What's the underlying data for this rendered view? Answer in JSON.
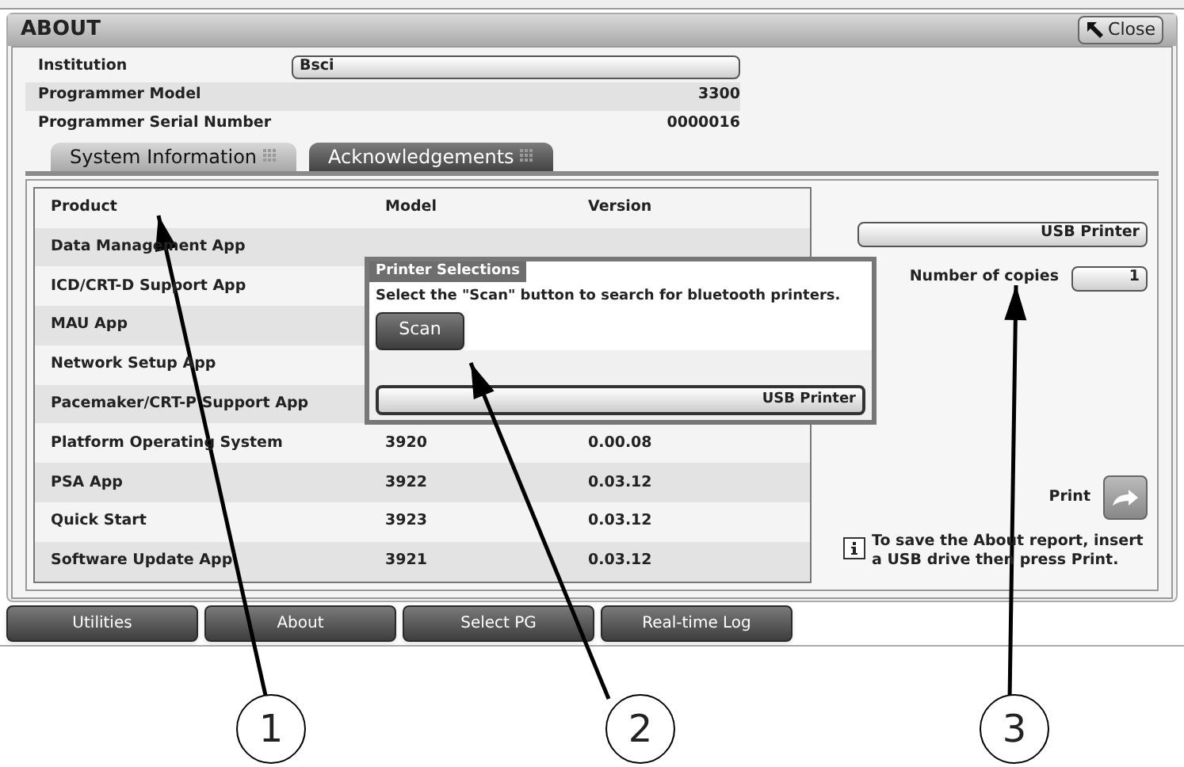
{
  "window": {
    "title": "ABOUT",
    "close_label": "Close"
  },
  "info": [
    {
      "label": "Institution",
      "value": "Bsci",
      "kind": "field"
    },
    {
      "label": "Programmer Model",
      "value": "3300",
      "kind": "text"
    },
    {
      "label": "Programmer Serial Number",
      "value": "0000016",
      "kind": "text"
    }
  ],
  "tabs": [
    {
      "label": "System Information",
      "selected": true
    },
    {
      "label": "Acknowledgements",
      "selected": false
    }
  ],
  "table": {
    "columns": [
      "Product",
      "Model",
      "Version"
    ],
    "rows": [
      {
        "product": "Data Management App"
      },
      {
        "product": "ICD/CRT-D Support App"
      },
      {
        "product": "MAU App"
      },
      {
        "product": "Network Setup App"
      },
      {
        "product": "Pacemaker/CRT-P Support App"
      },
      {
        "product": "Platform Operating System",
        "model": "3920",
        "version": "0.00.08"
      },
      {
        "product": "PSA App",
        "model": "3922",
        "version": "0.03.12"
      },
      {
        "product": "Quick Start",
        "model": "3923",
        "version": "0.03.12"
      },
      {
        "product": "Software Update App",
        "model": "3921",
        "version": "0.03.12"
      }
    ]
  },
  "printer": {
    "value": "USB Printer",
    "copies_label": "Number of copies",
    "copies": "1",
    "print_label": "Print",
    "note": "To save the About report, insert a USB drive then press Print."
  },
  "dialog": {
    "title": "Printer Selections",
    "message": "Select the \"Scan\" button to search for bluetooth printers.",
    "scan_label": "Scan",
    "selection": "USB Printer"
  },
  "nav_buttons": [
    "Utilities",
    "About",
    "Select PG",
    "Real-time Log"
  ],
  "callouts": [
    {
      "number": "1"
    },
    {
      "number": "2"
    },
    {
      "number": "3"
    }
  ]
}
